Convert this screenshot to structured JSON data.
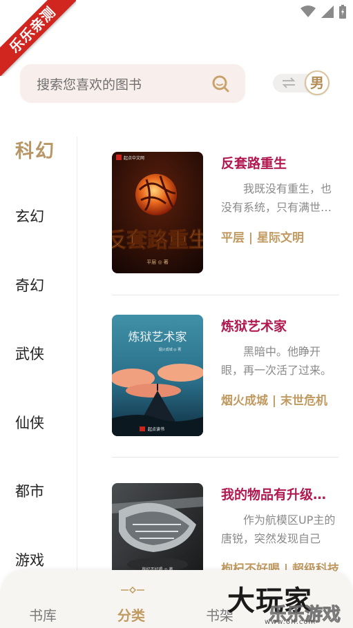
{
  "watermark_ribbon": "乐乐亲测",
  "search": {
    "placeholder": "搜索您喜欢的图书"
  },
  "gender": {
    "label": "男"
  },
  "categories": [
    "科幻",
    "玄幻",
    "奇幻",
    "武侠",
    "仙侠",
    "都市",
    "游戏"
  ],
  "active_category": "科幻",
  "books": [
    {
      "title": "反套路重生",
      "description": "我既没有重生，也没有系统，只有满世界的",
      "tags": "平层 | 星际文明",
      "cover": {
        "publisher": "起点中文网",
        "cover_title": "反套路重生",
        "author_line": "平层 ◎ 著"
      }
    },
    {
      "title": "炼狱艺术家",
      "description": "黑暗中。他睁开眼，再一次活了过来。",
      "tags": "烟火成城 | 末世危机",
      "cover": {
        "cover_title": "炼狱艺术家",
        "author_line": "烟火成城 ◎ 著",
        "publisher": "起点读书"
      }
    },
    {
      "title": "我的物品有升级面板",
      "description": "作为航模区UP主的唐锐，突然发现自己",
      "tags": "枸杞不好喝 | 超级科技",
      "cover": {
        "author_line": "枸杞不好喝 ◎ 著"
      }
    }
  ],
  "nav": {
    "tabs": [
      "书库",
      "分类",
      "书架"
    ],
    "active": "分类"
  },
  "watermark_logo": {
    "big": "大玩家",
    "small": "乐乐游戏",
    "url": "www.6ll.com"
  },
  "colors": {
    "accent": "#c09a61",
    "title": "#b0184f",
    "ribbon": "#d0261f"
  }
}
